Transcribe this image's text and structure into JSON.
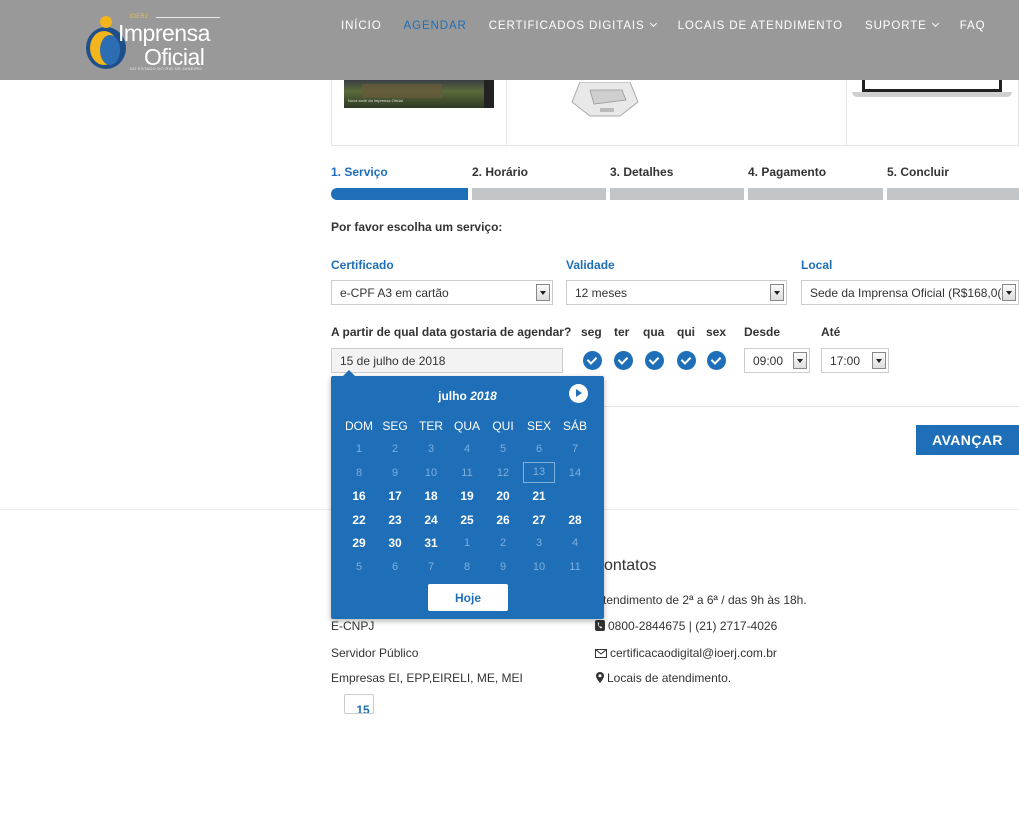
{
  "header": {
    "logo": {
      "line1": "Imprensa",
      "line2": "Oficial",
      "tiny": "IOERJ",
      "sub": "DO ESTADO DO RIO DE JANEIRO"
    },
    "nav": [
      {
        "label": "INÍCIO",
        "active": false,
        "dropdown": false
      },
      {
        "label": "AGENDAR",
        "active": true,
        "dropdown": false
      },
      {
        "label": "CERTIFICADOS DIGITAIS",
        "active": false,
        "dropdown": true
      },
      {
        "label": "LOCAIS DE ATENDIMENTO",
        "active": false,
        "dropdown": false
      },
      {
        "label": "SUPORTE",
        "active": false,
        "dropdown": true
      },
      {
        "label": "FAQ",
        "active": false,
        "dropdown": false
      }
    ]
  },
  "products": {
    "card_caption": "Nova sede da Imprensa Oficial"
  },
  "steps": [
    "1. Serviço",
    "2. Horário",
    "3. Detalhes",
    "4. Pagamento",
    "5. Concluir"
  ],
  "form": {
    "prompt": "Por favor escolha um serviço:",
    "certificado": {
      "label": "Certificado",
      "value": "e-CPF A3 em cartão"
    },
    "validade": {
      "label": "Validade",
      "value": "12 meses"
    },
    "local": {
      "label": "Local",
      "value": "Sede da Imprensa Oficial (R$168,0("
    },
    "date_label": "A partir de qual data gostaria de agendar?",
    "date_value": "15 de julho de 2018",
    "weekdays": [
      "seg",
      "ter",
      "qua",
      "qui",
      "sex"
    ],
    "desde": {
      "label": "Desde",
      "value": "09:00"
    },
    "ate": {
      "label": "Até",
      "value": "17:00"
    },
    "next_button": "AVANÇAR"
  },
  "calendar": {
    "month": "julho",
    "year": "2018",
    "headers": [
      "DOM",
      "SEG",
      "TER",
      "QUA",
      "QUI",
      "SEX",
      "SÁB"
    ],
    "weeks": [
      [
        "1",
        "2",
        "3",
        "4",
        "5",
        "6",
        "7"
      ],
      [
        "8",
        "9",
        "10",
        "11",
        "12",
        "13",
        "14"
      ],
      [
        "15",
        "16",
        "17",
        "18",
        "19",
        "20",
        "21"
      ],
      [
        "22",
        "23",
        "24",
        "25",
        "26",
        "27",
        "28"
      ],
      [
        "29",
        "30",
        "31",
        "1",
        "2",
        "3",
        "4"
      ],
      [
        "5",
        "6",
        "7",
        "8",
        "9",
        "10",
        "11"
      ]
    ],
    "today_button": "Hoje"
  },
  "footer": {
    "contatos_title": "Contatos",
    "contatos_partial": "ontatos",
    "hours": "tendimento de 2ª a 6ª / das 9h às 18h.",
    "phone": "0800-2844675 | (21) 2717-4026",
    "email": "certificacaodigital@ioerj.com.br",
    "locations": "Locais de atendimento.",
    "left_items": [
      "E-CNPJ",
      "Servidor Público",
      "Empresas EI, EPP,EIRELI, ME, MEI"
    ]
  },
  "colors": {
    "accent": "#1e6fb8",
    "topbar": "#999999",
    "bar_inactive": "#c2c6c9"
  }
}
